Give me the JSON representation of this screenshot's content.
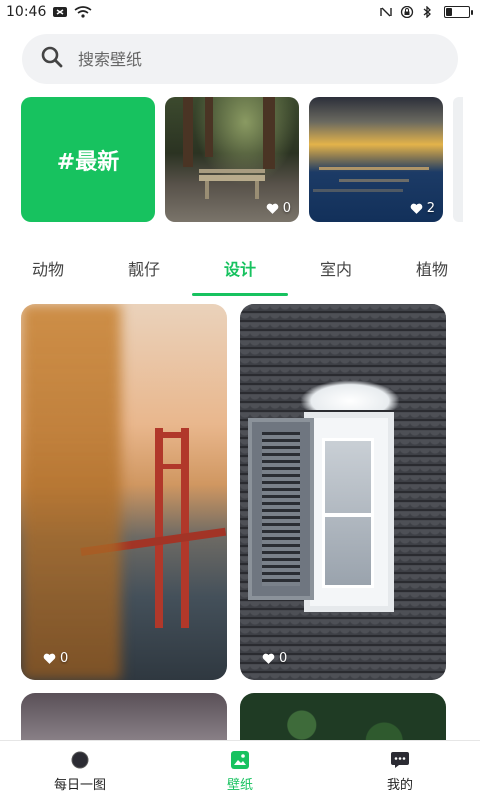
{
  "status_bar": {
    "time": "10:46",
    "battery_level": 0.25,
    "icons": [
      "notification-icon",
      "wifi-icon",
      "nfc-icon",
      "lock-icon",
      "bluetooth-icon",
      "battery-icon"
    ]
  },
  "search": {
    "placeholder": "搜索壁纸"
  },
  "featured": {
    "tag_label": "#最新",
    "cards": [
      {
        "name": "bench-forest",
        "likes": "0"
      },
      {
        "name": "sunset-lake",
        "likes": "2"
      }
    ]
  },
  "tabs": {
    "items": [
      "动物",
      "靓仔",
      "设计",
      "室内",
      "植物"
    ],
    "active_index": 2
  },
  "grid": {
    "cards": [
      {
        "name": "golden-gate-bridge",
        "likes": "0"
      },
      {
        "name": "window-shutter",
        "likes": "0"
      }
    ]
  },
  "bottom_nav": {
    "items": [
      {
        "label": "每日一图",
        "icon": "daily-icon"
      },
      {
        "label": "壁纸",
        "icon": "wallpaper-icon"
      },
      {
        "label": "我的",
        "icon": "chat-icon"
      }
    ],
    "active_index": 1
  },
  "colors": {
    "accent": "#17c25f"
  }
}
